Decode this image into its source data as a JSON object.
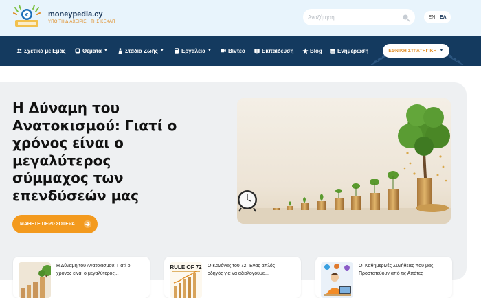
{
  "header": {
    "brand": "moneypedia.cy",
    "tagline": "ΥΠΟ ΤΗ ΔΙΑΧΕΙΡΙΣΗ ΤΗΣ ΚΕΧΑΠ",
    "search_placeholder": "Αναζήτηση",
    "languages": [
      {
        "label": "EN",
        "active": false
      },
      {
        "label": "ΕΛ",
        "active": true
      }
    ]
  },
  "nav": {
    "items": [
      {
        "label": "Σχετικά με Εμάς",
        "icon": "users-icon",
        "has_dropdown": false
      },
      {
        "label": "Θέματα",
        "icon": "layers-icon",
        "has_dropdown": true
      },
      {
        "label": "Στάδια Ζωής",
        "icon": "person-icon",
        "has_dropdown": true
      },
      {
        "label": "Εργαλεία",
        "icon": "calculator-icon",
        "has_dropdown": true
      },
      {
        "label": "Βίντεο",
        "icon": "video-icon",
        "has_dropdown": false
      },
      {
        "label": "Εκπαίδευση",
        "icon": "book-icon",
        "has_dropdown": false
      },
      {
        "label": "Blog",
        "icon": "star-icon",
        "has_dropdown": false
      },
      {
        "label": "Ενημέρωση",
        "icon": "calendar-icon",
        "has_dropdown": false
      }
    ],
    "strategy_button": "ΕΘΝΙΚΗ ΣΤΡΑΤΗΓΙΚΗ"
  },
  "hero": {
    "title_lines": [
      "Η Δύναμη του",
      "Ανατοκισμού: Γιατί ο",
      "χρόνος είναι ο",
      "μεγαλύτερος",
      "σύμμαχος των",
      "επενδύσεών μας"
    ],
    "cta_label": "ΜΑΘΕΤΕ ΠΕΡΙΣΣΟΤΕΡΑ",
    "image": "clock-and-growing-coin-stacks-with-trees"
  },
  "cards": [
    {
      "title_line1": "Η Δύναμη του Ανατοκισμού: Γιατί ο",
      "title_line2": "χρόνος είναι ο μεγαλύτερος...",
      "thumb": "coin-stacks-thumbnail"
    },
    {
      "title_line1": "Ο Κανόνας του 72: Ένας απλός",
      "title_line2": "οδηγός για να αξιολογούμε...",
      "thumb": "rule-of-72-thumbnail",
      "thumb_text": "RULE OF 72"
    },
    {
      "title_line1": "Οι Καθημερινές Συνήθειες που μας",
      "title_line2": "Προστατεύουν από τις Απάτες",
      "thumb": "person-at-laptop-thumbnail"
    }
  ],
  "colors": {
    "nav_bg": "#143a5f",
    "accent": "#f39a1e",
    "topbar_bg": "#e8f4fc",
    "hero_bg": "#eef0f2"
  }
}
